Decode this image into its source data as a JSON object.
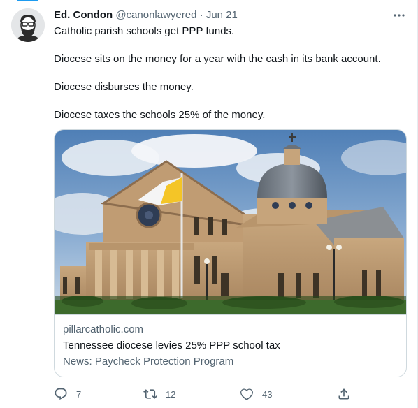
{
  "tweet": {
    "author_name": "Ed. Condon",
    "handle": "@canonlawyered",
    "separator": "·",
    "date": "Jun 21",
    "more_icon": "more-dots-icon",
    "paragraphs": [
      "Catholic parish schools get PPP funds.",
      "Diocese sits on the money for a year with the cash in its bank account.",
      "Diocese disburses the money.",
      "Diocese taxes the schools 25% of the money."
    ]
  },
  "card": {
    "domain": "pillarcatholic.com",
    "title": "Tennessee diocese levies 25% PPP school tax",
    "description": "News: Paycheck Protection Program",
    "image": "cathedral-photo"
  },
  "actions": {
    "reply_icon": "reply-icon",
    "reply_count": "7",
    "retweet_icon": "retweet-icon",
    "retweet_count": "12",
    "like_icon": "heart-icon",
    "like_count": "43",
    "share_icon": "share-icon"
  },
  "colors": {
    "accent": "#1d9bf0",
    "text_primary": "#0f1419",
    "text_secondary": "#536471",
    "border": "#cfd9de"
  }
}
